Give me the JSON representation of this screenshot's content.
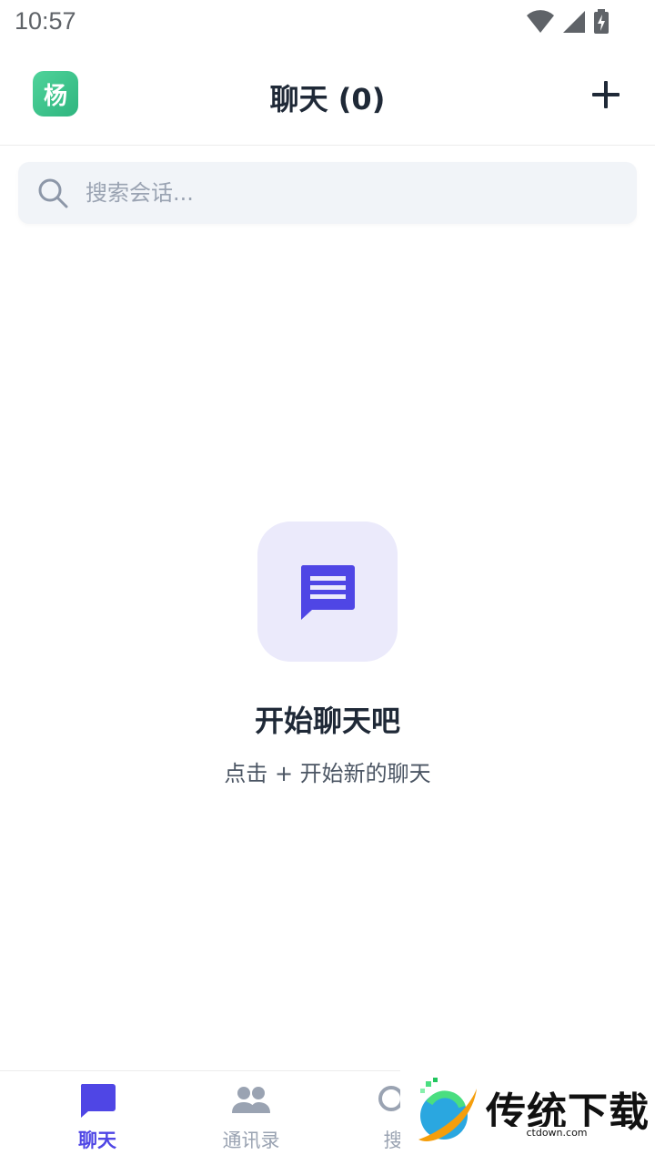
{
  "status_bar": {
    "time": "10:57"
  },
  "header": {
    "avatar_text": "杨",
    "title": "聊天 (0)",
    "add_icon": "plus-icon"
  },
  "search": {
    "placeholder": "搜索会话...",
    "value": ""
  },
  "empty_state": {
    "icon": "chat-bubble-icon",
    "title": "开始聊天吧",
    "subtitle": "点击 + 开始新的聊天"
  },
  "bottom_nav": {
    "items": [
      {
        "label": "聊天",
        "icon": "chat-icon",
        "active": true
      },
      {
        "label": "通讯录",
        "icon": "contacts-icon",
        "active": false
      },
      {
        "label": "搜",
        "icon": "search-icon",
        "active": false
      }
    ]
  },
  "watermark": {
    "title": "传统下载",
    "subtitle": "ctdown.com"
  },
  "colors": {
    "accent": "#4f46e5",
    "avatar": "#34c38b",
    "empty_icon_bg": "#ebeafb",
    "search_bg": "#f1f4f8"
  }
}
